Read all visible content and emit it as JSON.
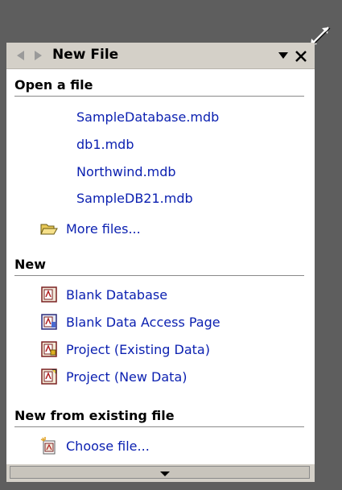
{
  "pane": {
    "title": "New File",
    "sections": {
      "open": {
        "header": "Open a file"
      },
      "new": {
        "header": "New"
      },
      "existing": {
        "header": "New from existing file"
      }
    },
    "recent_files": [
      "SampleDatabase.mdb",
      "db1.mdb",
      "Northwind.mdb",
      "SampleDB21.mdb"
    ],
    "more_files": {
      "label": "More files...",
      "icon": "open-folder-icon"
    },
    "new_items": [
      {
        "label": "Blank Database",
        "icon": "blank-database-icon"
      },
      {
        "label": "Blank Data Access Page",
        "icon": "data-access-page-icon"
      },
      {
        "label": "Project (Existing Data)",
        "icon": "project-existing-data-icon"
      },
      {
        "label": "Project (New Data)",
        "icon": "project-new-data-icon"
      }
    ],
    "existing_items": [
      {
        "label": "Choose file...",
        "icon": "choose-file-icon"
      }
    ]
  },
  "colors": {
    "background": "#5e5e5e",
    "titlebar": "#d4d0c8",
    "link": "#0a1fb0",
    "pane": "#ffffff"
  }
}
